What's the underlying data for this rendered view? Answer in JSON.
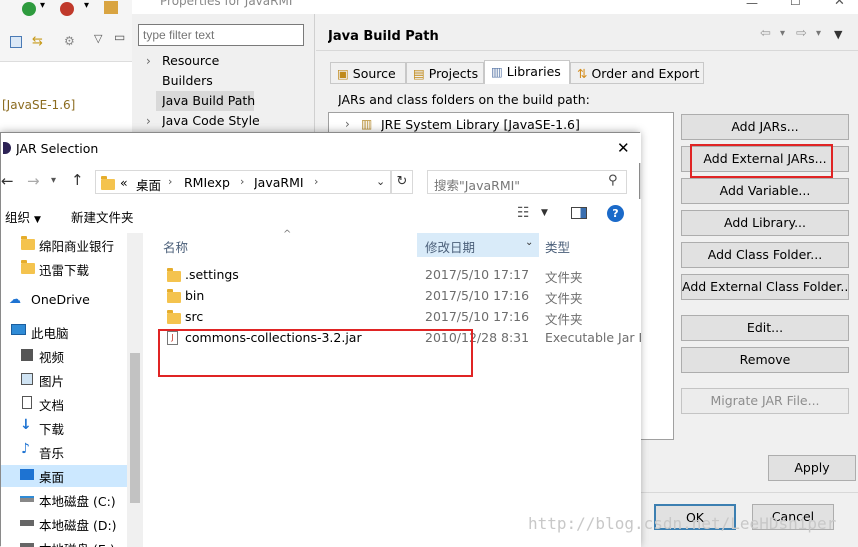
{
  "eclipse": {
    "jre_label": "[JavaSE-1.6]"
  },
  "properties": {
    "title": "Properties for JavaRMI",
    "filter_placeholder": "type filter text",
    "tree": [
      "Resource",
      "Builders",
      "Java Build Path",
      "Java Code Style"
    ],
    "page_title": "Java Build Path",
    "tabs": [
      "Source",
      "Projects",
      "Libraries",
      "Order and Export"
    ],
    "jars_label": "JARs and class folders on the build path:",
    "library_item": "JRE System Library [JavaSE-1.6]",
    "buttons": {
      "add_jars": "Add JARs...",
      "add_external_jars": "Add External JARs...",
      "add_variable": "Add Variable...",
      "add_library": "Add Library...",
      "add_class_folder": "Add Class Folder...",
      "add_external_class_folder": "Add External Class Folder...",
      "edit": "Edit...",
      "remove": "Remove",
      "migrate_jar": "Migrate JAR File...",
      "apply": "Apply",
      "ok": "OK",
      "cancel": "Cancel"
    }
  },
  "jar_dialog": {
    "title": "JAR Selection",
    "breadcrumb": [
      "«",
      "桌面",
      "RMIexp",
      "JavaRMI"
    ],
    "search_placeholder": "搜索\"JavaRMI\"",
    "organize": "组织",
    "new_folder": "新建文件夹",
    "nav": {
      "fav1": "绵阳商业银行",
      "fav2": "迅雷下载",
      "onedrive": "OneDrive",
      "this_pc": "此电脑",
      "videos": "视频",
      "pictures": "图片",
      "documents": "文档",
      "downloads": "下载",
      "music": "音乐",
      "desktop": "桌面",
      "drive_c": "本地磁盘 (C:)",
      "drive_d": "本地磁盘 (D:)",
      "drive_e": "本地磁盘 (E:)"
    },
    "columns": {
      "name": "名称",
      "modified": "修改日期",
      "type": "类型"
    },
    "files": [
      {
        "name": ".settings",
        "date": "2017/5/10 17:17",
        "type": "文件夹"
      },
      {
        "name": "bin",
        "date": "2017/5/10 17:16",
        "type": "文件夹"
      },
      {
        "name": "src",
        "date": "2017/5/10 17:16",
        "type": "文件夹"
      },
      {
        "name": "commons-collections-3.2.jar",
        "date": "2010/12/28 8:31",
        "type": "Executable Jar File"
      }
    ]
  },
  "watermark": "http://blog.csdn.net/LeeHDsniper",
  "colors": {
    "highlight_red": "#e02424",
    "selection_blue": "#cce8ff",
    "folder_yellow": "#f4c34e"
  }
}
